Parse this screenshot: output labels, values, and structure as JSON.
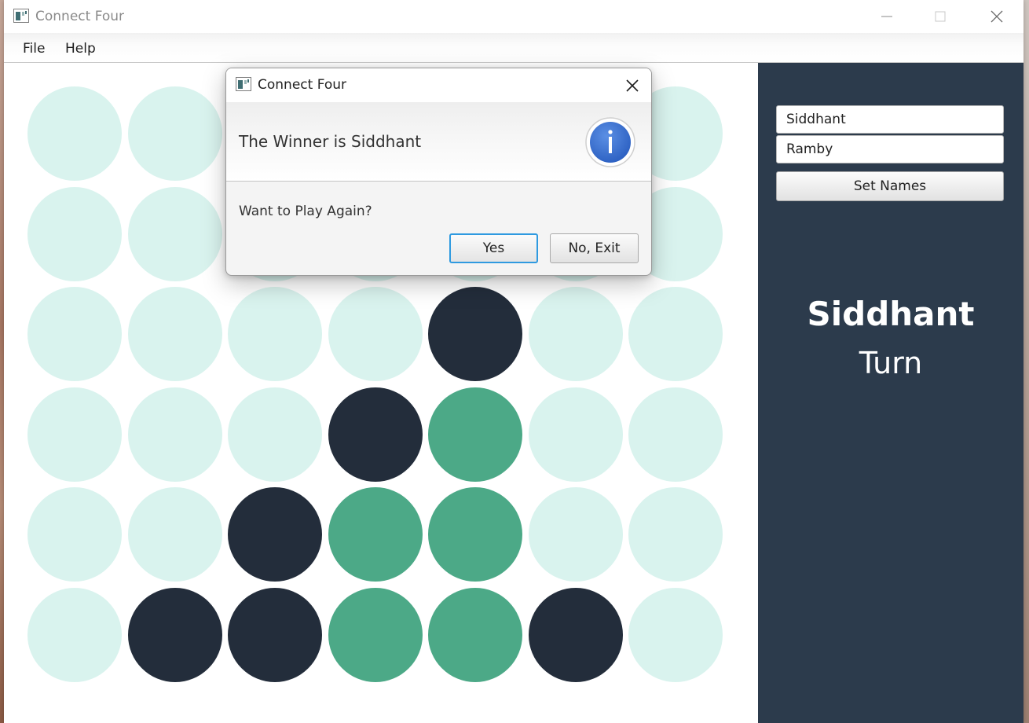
{
  "window": {
    "title": "Connect Four",
    "icon": "java-app-icon"
  },
  "menu": {
    "items": [
      {
        "label": "File"
      },
      {
        "label": "Help"
      }
    ]
  },
  "board": {
    "rows": 6,
    "columns": 7,
    "cells": [
      [
        "empty",
        "empty",
        "empty",
        "empty",
        "empty",
        "empty",
        "empty"
      ],
      [
        "empty",
        "empty",
        "empty",
        "empty",
        "empty",
        "empty",
        "empty"
      ],
      [
        "empty",
        "empty",
        "empty",
        "empty",
        "dark",
        "empty",
        "empty"
      ],
      [
        "empty",
        "empty",
        "empty",
        "dark",
        "green",
        "empty",
        "empty"
      ],
      [
        "empty",
        "empty",
        "dark",
        "green",
        "green",
        "empty",
        "empty"
      ],
      [
        "empty",
        "dark",
        "dark",
        "green",
        "green",
        "dark",
        "empty"
      ]
    ],
    "colors": {
      "empty": "#d9f3ee",
      "dark": "#232d3b",
      "green": "#4ca987"
    }
  },
  "sidebar": {
    "player1": "Siddhant",
    "player2": "Ramby",
    "set_names_label": "Set Names",
    "turn_player": "Siddhant",
    "turn_label": "Turn",
    "background": "#2c3b4c"
  },
  "dialog": {
    "title": "Connect Four",
    "header": "The Winner is Siddhant",
    "content": "Want to Play Again?",
    "yes_label": "Yes",
    "no_label": "No, Exit",
    "icon": "info-icon"
  }
}
